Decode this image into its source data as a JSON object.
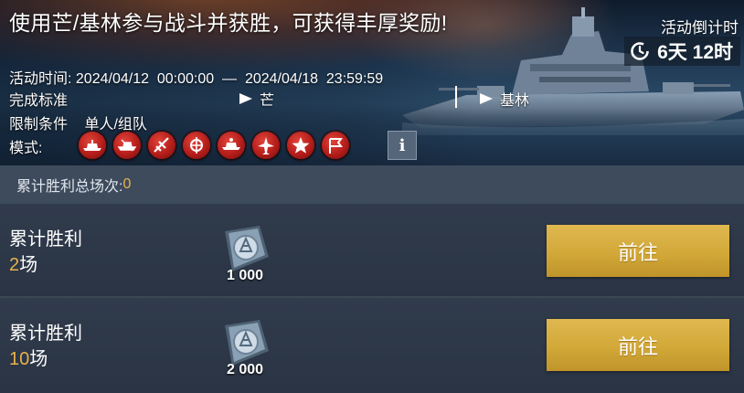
{
  "event": {
    "title": "使用芒/基林参与战斗并获胜，可获得丰厚奖励!",
    "countdown_label": "活动倒计时",
    "countdown_value": "6天 12时",
    "time_label": "活动时间:",
    "time_range": "2024/04/12  00:00:00  —  2024/04/18  23:59:59",
    "criteria_label": "完成标准",
    "criteria_ships": [
      "芒",
      "基林"
    ],
    "limit_label": "限制条件",
    "limit_value": "单人/组队",
    "mode_label": "模式:",
    "mode_icons": [
      "battleship-icon",
      "cruiser-icon",
      "aircraft-icon",
      "submarine-icon",
      "destroyer-icon",
      "airplane-icon",
      "star-icon",
      "flag-icon"
    ],
    "info_button": "i"
  },
  "total": {
    "label": "累计胜利总场次:",
    "value": "0"
  },
  "rewards": [
    {
      "label": "累计胜利",
      "count": "2",
      "unit": "场",
      "amount": "1 000",
      "button": "前往",
      "icon": "silver-coin-icon"
    },
    {
      "label": "累计胜利",
      "count": "10",
      "unit": "场",
      "amount": "2 000",
      "button": "前往",
      "icon": "silver-coin-icon"
    }
  ],
  "colors": {
    "accent_gold": "#e8b24a",
    "button_gold": "#d2a838",
    "panel_bg": "#2a3444",
    "strip_bg": "#3e4b5c",
    "mode_icon_red": "#b51d1a"
  }
}
